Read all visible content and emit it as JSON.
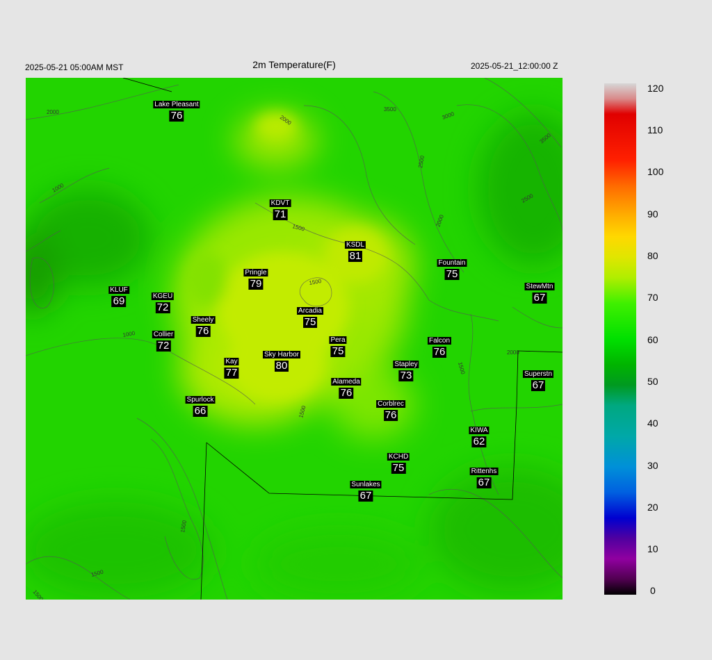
{
  "header": {
    "local_time": "2025-05-21 05:00AM MST",
    "title": "2m Temperature(F)",
    "utc_time": "2025-05-21_12:00:00 Z"
  },
  "colorbar": {
    "ticks": [
      "120",
      "110",
      "100",
      "90",
      "80",
      "70",
      "60",
      "50",
      "40",
      "30",
      "20",
      "10",
      "0"
    ]
  },
  "contours": [
    "2000",
    "2000",
    "3500",
    "3000",
    "3500",
    "2500",
    "2000",
    "2500",
    "1500",
    "1500",
    "1000",
    "1500",
    "2000",
    "1500",
    "1500",
    "1000",
    "1500",
    "1500"
  ],
  "stations": [
    {
      "name": "Lake Pleasant",
      "value": "76"
    },
    {
      "name": "KDVT",
      "value": "71"
    },
    {
      "name": "KSDL",
      "value": "81"
    },
    {
      "name": "Fountain",
      "value": "75"
    },
    {
      "name": "StewMtn",
      "value": "67"
    },
    {
      "name": "Pringle",
      "value": "79"
    },
    {
      "name": "KLUF",
      "value": "69"
    },
    {
      "name": "KGEU",
      "value": "72"
    },
    {
      "name": "Arcadia",
      "value": "75"
    },
    {
      "name": "Sheely",
      "value": "76"
    },
    {
      "name": "Collier",
      "value": "72"
    },
    {
      "name": "Pera",
      "value": "75"
    },
    {
      "name": "Falcon",
      "value": "76"
    },
    {
      "name": "Kay",
      "value": "77"
    },
    {
      "name": "Sky Harbor",
      "value": "80"
    },
    {
      "name": "Stapley",
      "value": "73"
    },
    {
      "name": "Superstn",
      "value": "67"
    },
    {
      "name": "Alameda",
      "value": "76"
    },
    {
      "name": "Spurlock",
      "value": "66"
    },
    {
      "name": "Corblrec",
      "value": "76"
    },
    {
      "name": "KIWA",
      "value": "62"
    },
    {
      "name": "KCHD",
      "value": "75"
    },
    {
      "name": "Rittenhs",
      "value": "67"
    },
    {
      "name": "Sunlakes",
      "value": "67"
    }
  ]
}
